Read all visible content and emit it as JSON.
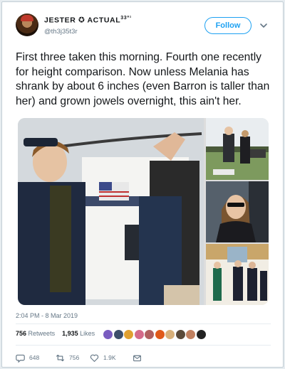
{
  "user": {
    "display_name": "JESTER ✪ ACTUAL",
    "display_sup": "33⁰¹",
    "handle": "@th3j35t3r",
    "avatar_icon": "jester-avatar"
  },
  "follow_label": "Follow",
  "tweet": {
    "text": "First three taken this morning. Fourth one recently for height comparison. Now unless Melania has shrank by about 6 inches (even Barron is taller than her) and grown jowels overnight, this ain't her."
  },
  "timestamp": "2:04 PM - 8 Mar 2019",
  "stats": {
    "retweets_count": "756",
    "retweets_label": "Retweets",
    "likes_count": "1,935",
    "likes_label": "Likes"
  },
  "actions": {
    "reply_count": "648",
    "retweet_count": "756",
    "like_count": "1.9K"
  },
  "colors": {
    "accent": "#1da1f2",
    "secondary_text": "#657786",
    "border": "#e6ecf0"
  },
  "liker_colors": [
    "#7a5cc0",
    "#3d4f6b",
    "#e0a030",
    "#d46a8a",
    "#b06060",
    "#e05a1a",
    "#d8b07a",
    "#5a4a3a",
    "#c08060",
    "#222222"
  ]
}
